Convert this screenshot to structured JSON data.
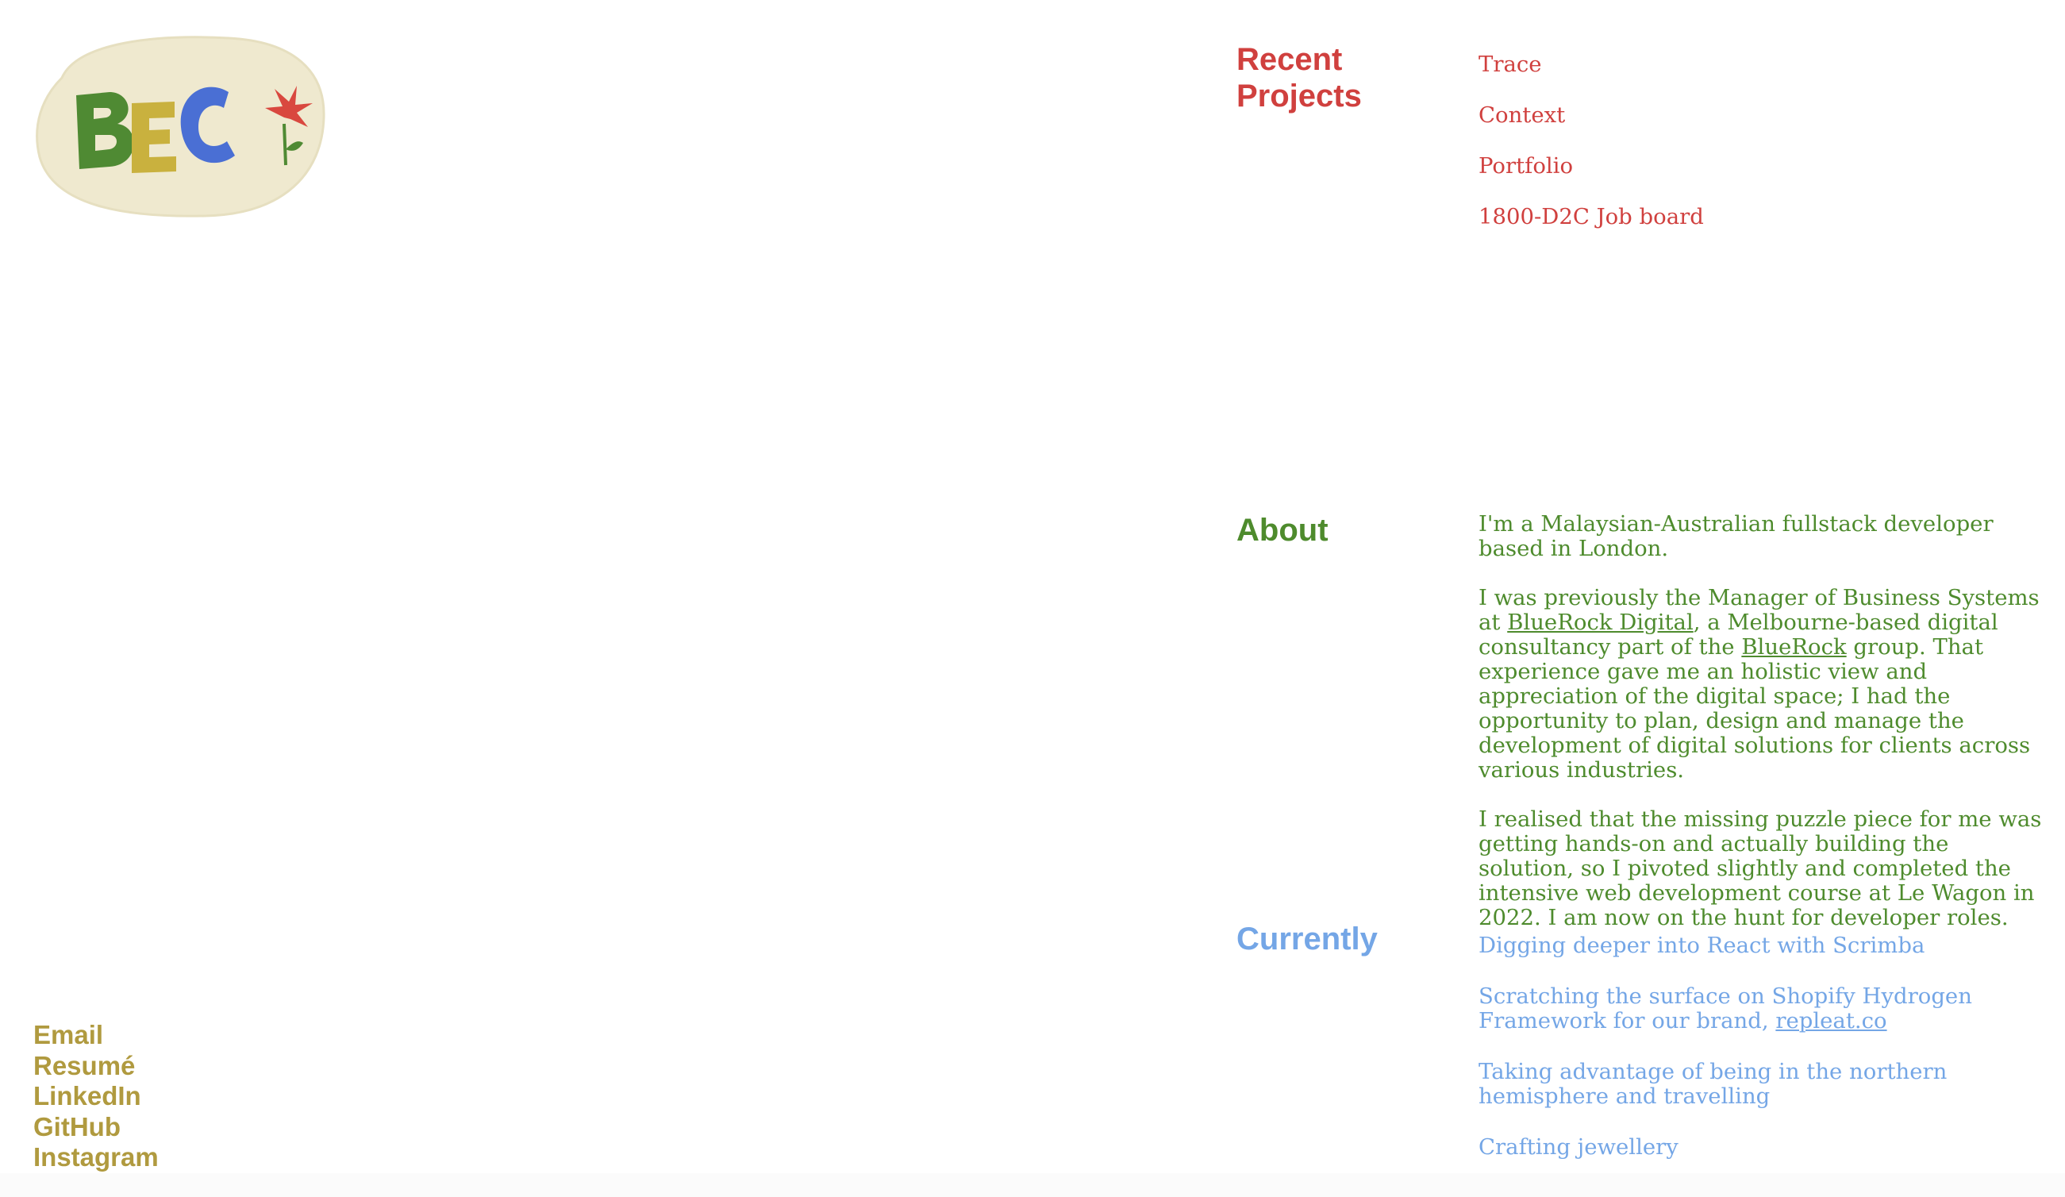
{
  "logo": {
    "text": "BEC"
  },
  "contact_links": [
    "Email",
    "Resumé",
    "LinkedIn",
    "GitHub",
    "Instagram"
  ],
  "projects": {
    "title": "Recent Projects",
    "items": [
      "Trace",
      "Context",
      "Portfolio",
      "1800-D2C Job board"
    ]
  },
  "about": {
    "title": "About",
    "p1": "I'm a Malaysian-Australian fullstack developer based in London.",
    "p2_a": "I was previously the Manager of Business Systems at ",
    "p2_link1": "BlueRock Digital",
    "p2_b": ", a Melbourne-based digital consultancy part of the ",
    "p2_link2": "BlueRock",
    "p2_c": " group. That experience gave me an holistic view and appreciation of the digital space; I had the opportunity to plan, design and manage the development of digital solutions for clients across various industries.",
    "p3": "I realised that the missing puzzle piece for me was getting hands-on and actually building the solution, so I pivoted slightly and completed the intensive web development course at Le Wagon in 2022. I am now on the hunt for developer roles."
  },
  "currently": {
    "title": "Currently",
    "item1": "Digging deeper into React with Scrimba",
    "item2_a": "Scratching the surface on Shopify Hydrogen Framework for our brand, ",
    "item2_link": "repleat.co",
    "item3": "Taking advantage of being in the northern hemisphere and travelling",
    "item4": "Crafting jewellery"
  },
  "colors": {
    "red": "#d0403e",
    "green": "#4e8b2d",
    "blue": "#74a6e6",
    "mustard": "#b09a3f",
    "logo_bg": "#efe9cf"
  }
}
